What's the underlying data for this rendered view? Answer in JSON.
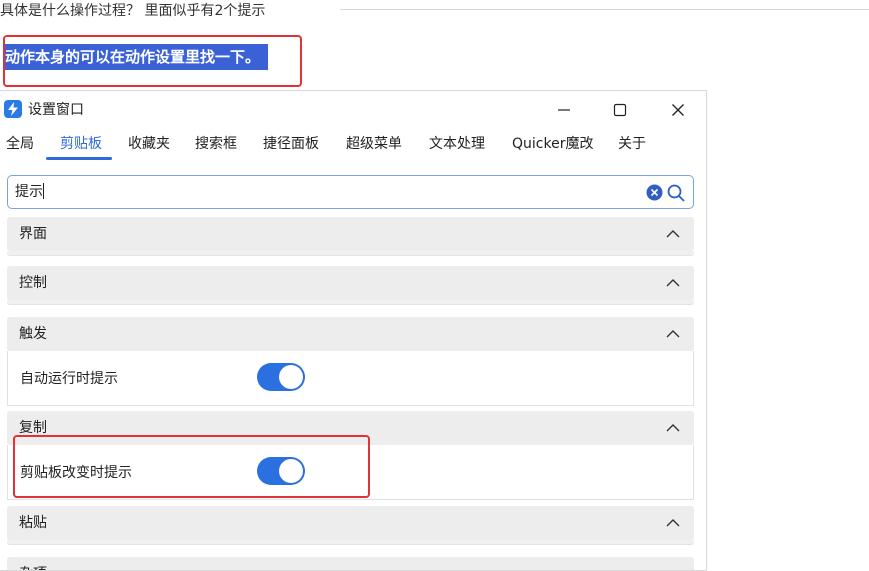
{
  "question": "具体是什么操作过程？ 里面似乎有2个提示",
  "answer_highlight": "动作本身的可以在动作设置里找一下。",
  "window": {
    "title": "设置窗口"
  },
  "tabs": [
    "全局",
    "剪贴板",
    "收藏夹",
    "搜索框",
    "捷径面板",
    "超级菜单",
    "文本处理",
    "Quicker魔改",
    "关于"
  ],
  "active_tab": "剪贴板",
  "search": {
    "value": "提示"
  },
  "sections": [
    {
      "title": "界面",
      "expanded": true
    },
    {
      "title": "控制",
      "expanded": true
    },
    {
      "title": "触发",
      "expanded": true,
      "setting": {
        "label": "自动运行时提示",
        "enabled": true
      }
    },
    {
      "title": "复制",
      "expanded": true,
      "setting": {
        "label": "剪贴板改变时提示",
        "enabled": true
      }
    },
    {
      "title": "粘贴",
      "expanded": true
    },
    {
      "title": "杂项",
      "expanded": true
    }
  ],
  "colors": {
    "accent": "#2f6bd8",
    "toggle_on": "#2b6fe0",
    "highlight_bg": "#3a62d6",
    "annotation_red": "#e03434",
    "section_bg": "#ededed"
  }
}
